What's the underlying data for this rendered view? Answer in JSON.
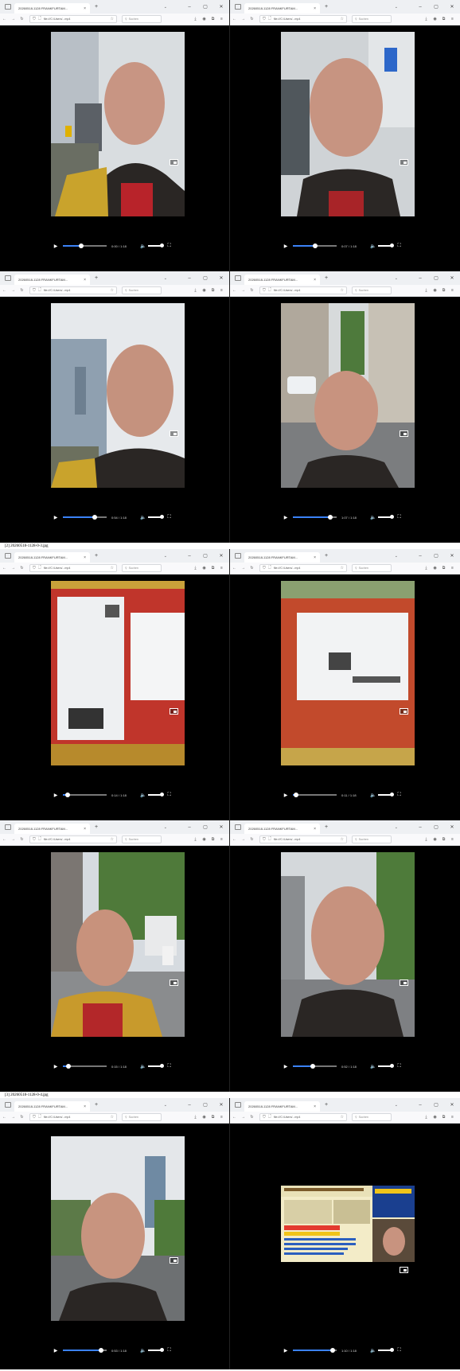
{
  "captions": [
    "[2] 20260518-1128-0-3.jpg",
    "[3] 20260518-1128-0-4.jpg"
  ],
  "browser": {
    "tab_title": "20260518-1128 FRANKFURTAM...",
    "tab_title_right": "20260518-1128 FRANKFURTAM...",
    "url": "file:///C:/Users/...mp4",
    "search_placeholder": "Suchen"
  },
  "video_times": [
    "0:00 / 1:18",
    "0:07 / 1:18",
    "0:54 / 1:18",
    "1:07 / 1:18",
    "0:14 / 1:18",
    "0:11 / 1:18",
    "0:15 / 1:18",
    "0:52 / 1:18",
    "0:53 / 1:18",
    "1:10 / 1:18"
  ],
  "progress": [
    0.42,
    0.5,
    0.72,
    0.85,
    0.1,
    0.08,
    0.12,
    0.45,
    0.88,
    0.9
  ],
  "icons": {
    "tab": "window-icon",
    "new_tab": "plus-icon",
    "back": "arrow-left-icon",
    "forward": "arrow-right-icon",
    "reload": "reload-icon",
    "shield": "shield-icon",
    "lock": "lock-icon",
    "star": "star-icon",
    "download": "download-icon",
    "account": "account-icon",
    "extensions": "puzzle-icon",
    "menu": "menu-icon",
    "play": "play-icon",
    "volume": "speaker-icon",
    "fullscreen": "fullscreen-icon",
    "pip": "picture-in-picture-icon"
  },
  "colors": {
    "progress": "#3b82f6",
    "chrome": "#eef0f3",
    "video_bg": "#000000"
  }
}
